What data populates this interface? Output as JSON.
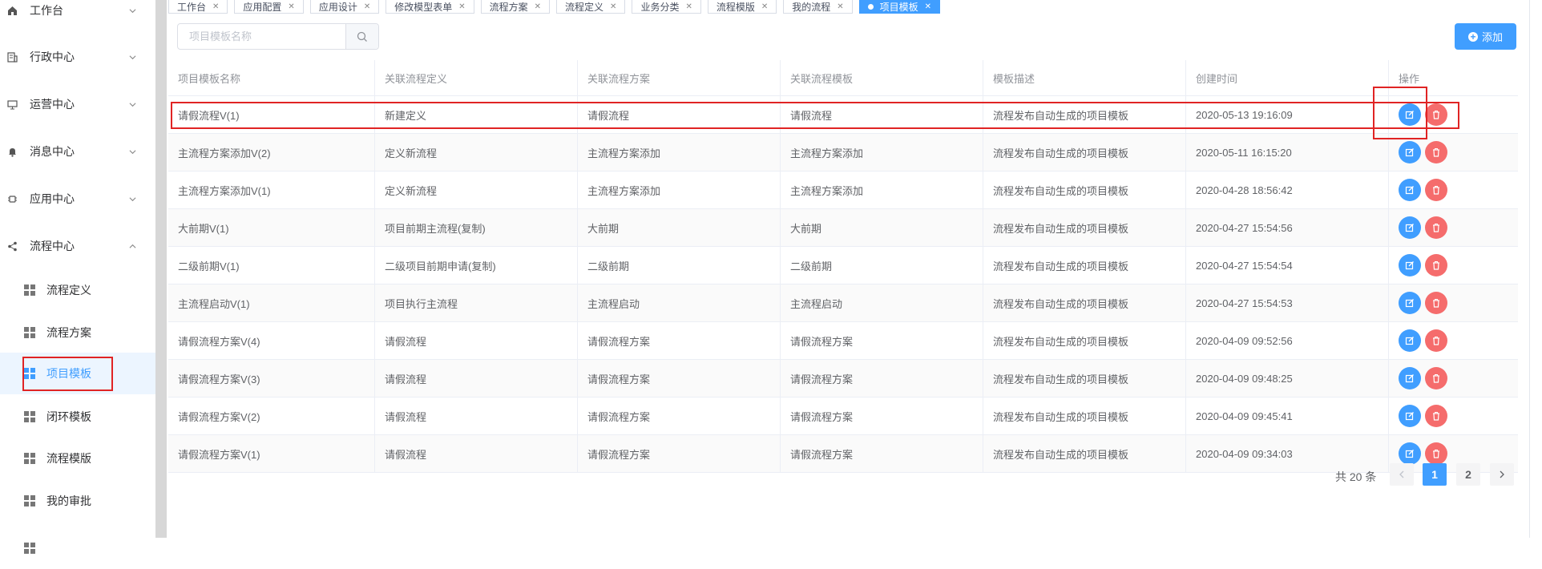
{
  "sidebar": {
    "menus": [
      {
        "label": "工作台",
        "icon": "home-icon"
      },
      {
        "label": "行政中心",
        "icon": "building-icon"
      },
      {
        "label": "运营中心",
        "icon": "presentation-icon"
      },
      {
        "label": "消息中心",
        "icon": "bell-icon"
      },
      {
        "label": "应用中心",
        "icon": "chip-icon"
      },
      {
        "label": "流程中心",
        "icon": "share-icon"
      }
    ],
    "submenus": [
      {
        "label": "流程定义"
      },
      {
        "label": "流程方案"
      },
      {
        "label": "项目模板"
      },
      {
        "label": "闭环模板"
      },
      {
        "label": "流程模版"
      },
      {
        "label": "我的审批"
      }
    ]
  },
  "tabs": [
    {
      "label": "工作台"
    },
    {
      "label": "应用配置"
    },
    {
      "label": "应用设计"
    },
    {
      "label": "修改模型表单"
    },
    {
      "label": "流程方案"
    },
    {
      "label": "流程定义"
    },
    {
      "label": "业务分类"
    },
    {
      "label": "流程模版"
    },
    {
      "label": "我的流程"
    },
    {
      "label": "项目模板"
    }
  ],
  "toolbar": {
    "search_placeholder": "项目模板名称",
    "add_label": "添加"
  },
  "table": {
    "columns": [
      "项目模板名称",
      "关联流程定义",
      "关联流程方案",
      "关联流程模板",
      "模板描述",
      "创建时间",
      "操作"
    ],
    "rows": [
      [
        "请假流程V(1)",
        "新建定义",
        "请假流程",
        "请假流程",
        "流程发布自动生成的项目模板",
        "2020-05-13 19:16:09"
      ],
      [
        "主流程方案添加V(2)",
        "定义新流程",
        "主流程方案添加",
        "主流程方案添加",
        "流程发布自动生成的项目模板",
        "2020-05-11 16:15:20"
      ],
      [
        "主流程方案添加V(1)",
        "定义新流程",
        "主流程方案添加",
        "主流程方案添加",
        "流程发布自动生成的项目模板",
        "2020-04-28 18:56:42"
      ],
      [
        "大前期V(1)",
        "项目前期主流程(复制)",
        "大前期",
        "大前期",
        "流程发布自动生成的项目模板",
        "2020-04-27 15:54:56"
      ],
      [
        "二级前期V(1)",
        "二级项目前期申请(复制)",
        "二级前期",
        "二级前期",
        "流程发布自动生成的项目模板",
        "2020-04-27 15:54:54"
      ],
      [
        "主流程启动V(1)",
        "项目执行主流程",
        "主流程启动",
        "主流程启动",
        "流程发布自动生成的项目模板",
        "2020-04-27 15:54:53"
      ],
      [
        "请假流程方案V(4)",
        "请假流程",
        "请假流程方案",
        "请假流程方案",
        "流程发布自动生成的项目模板",
        "2020-04-09 09:52:56"
      ],
      [
        "请假流程方案V(3)",
        "请假流程",
        "请假流程方案",
        "请假流程方案",
        "流程发布自动生成的项目模板",
        "2020-04-09 09:48:25"
      ],
      [
        "请假流程方案V(2)",
        "请假流程",
        "请假流程方案",
        "请假流程方案",
        "流程发布自动生成的项目模板",
        "2020-04-09 09:45:41"
      ],
      [
        "请假流程方案V(1)",
        "请假流程",
        "请假流程方案",
        "请假流程方案",
        "流程发布自动生成的项目模板",
        "2020-04-09 09:34:03"
      ]
    ]
  },
  "pagination": {
    "total_text": "共 20 条",
    "pages": [
      "1",
      "2"
    ],
    "current": "1"
  },
  "colors": {
    "primary": "#409eff",
    "danger": "#f56c6c",
    "highlight_box": "#e02424"
  }
}
